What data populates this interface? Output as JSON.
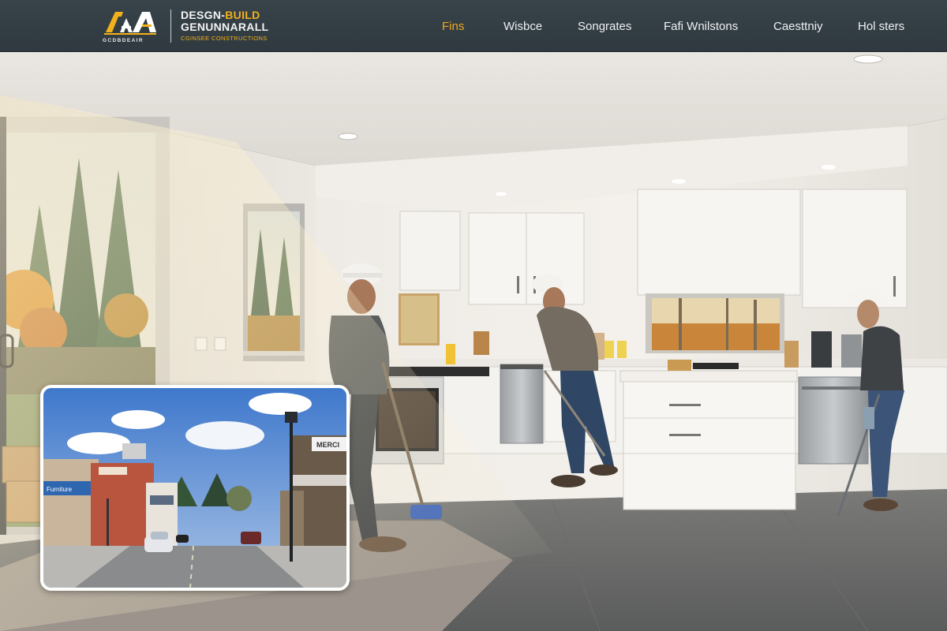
{
  "header": {
    "logo": {
      "mark_text": "AA",
      "sub_text": "GCDBDEAIR",
      "line1_a": "DESGN-",
      "line1_b": "BUILD",
      "line2": "GENUNNARALL",
      "line3": "CGINSEE CONSTRUCTIONS"
    },
    "nav": [
      {
        "label": "Fins",
        "active": true
      },
      {
        "label": "Wisbce",
        "active": false
      },
      {
        "label": "Songrates",
        "active": false
      },
      {
        "label": "Fafi Wnilstons",
        "active": false
      },
      {
        "label": "Caesttniy",
        "active": false
      },
      {
        "label": "Hol sters",
        "active": false
      }
    ]
  },
  "hero": {
    "description": "",
    "colors": {
      "accent": "#f2a91c",
      "header_bg": "#343e45"
    }
  },
  "inset": {
    "store_sign_1": "Furniture",
    "store_sign_2": "MERCI",
    "store_sign_3": "Furniture"
  }
}
